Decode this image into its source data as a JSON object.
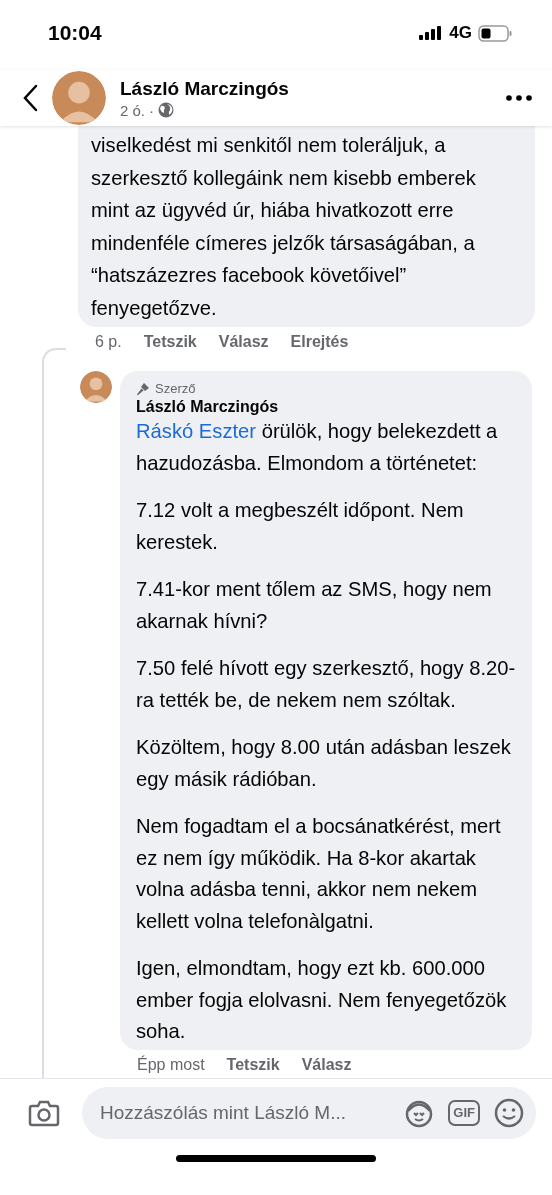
{
  "status_bar": {
    "time": "10:04",
    "network": "4G"
  },
  "header": {
    "name": "László Marczingós",
    "time": "2 ó.",
    "separator": "·"
  },
  "comment": {
    "text": "viselkedést mi senkitől nem toleráljuk, a szerkesztő kollegáink nem kisebb emberek mint az ügyvéd úr, hiába hivatkozott erre mindenféle címeres jelzők társaságában, a “hatszázezres facebook követőivel” fenyegetőzve.",
    "time": "6 p.",
    "actions": [
      "Tetszik",
      "Válasz",
      "Elrejtés"
    ]
  },
  "reply": {
    "badge": "Szerző",
    "author": "László Marczingós",
    "mention": "Ráskó Eszter",
    "paragraphs": [
      " örülök, hogy belekezdett a hazudozásba. Elmondom a történetet:",
      "7.12 volt a megbeszélt időpont. Nem kerestek.",
      "7.41-kor ment tőlem az SMS, hogy nem akarnak hívni?",
      "7.50 felé hívott egy szerkesztő, hogy 8.20-ra tették be, de nekem nem szóltak.",
      "Közöltem, hogy 8.00 után adásban leszek egy másik rádióban.",
      "Nem fogadtam el a bocsánatkérést, mert ez nem így működik. Ha 8-kor akartak volna adásba tenni, akkor nem nekem kellett volna telefonàlgatni.",
      "Igen, elmondtam, hogy ezt kb. 600.000 ember fogja elolvasni. Nem fenyegetőzök soha."
    ],
    "time": "Épp most",
    "actions": [
      "Tetszik",
      "Válasz"
    ]
  },
  "composer": {
    "placeholder": "Hozzászólás mint László M...",
    "gif": "GIF"
  }
}
